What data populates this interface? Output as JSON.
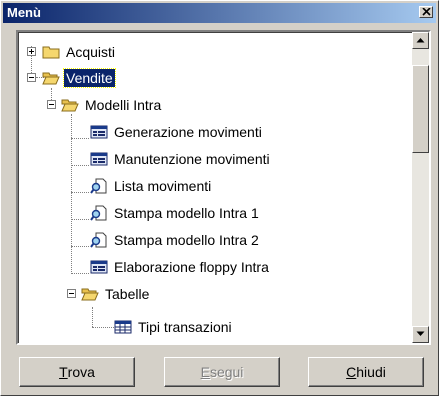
{
  "window": {
    "title": "Menù"
  },
  "tree": {
    "items": [
      {
        "label": "Acquisti",
        "icon": "folder-closed-icon",
        "expander": "plus"
      },
      {
        "label": "Vendite",
        "icon": "folder-open-icon",
        "expander": "minus",
        "selected": true
      },
      {
        "label": "Modelli Intra",
        "icon": "folder-open-icon",
        "expander": "minus"
      },
      {
        "label": "Generazione movimenti",
        "icon": "form-icon"
      },
      {
        "label": "Manutenzione movimenti",
        "icon": "form-icon"
      },
      {
        "label": "Lista movimenti",
        "icon": "report-icon"
      },
      {
        "label": "Stampa modello Intra 1",
        "icon": "report-icon"
      },
      {
        "label": "Stampa modello Intra 2",
        "icon": "report-icon"
      },
      {
        "label": "Elaborazione floppy Intra",
        "icon": "form-icon"
      },
      {
        "label": "Tabelle",
        "icon": "folder-open-icon",
        "expander": "minus"
      },
      {
        "label": "Tipi transazioni",
        "icon": "table-icon"
      }
    ]
  },
  "buttons": {
    "find": {
      "accel": "T",
      "rest": "rova"
    },
    "run": {
      "accel": "E",
      "rest": "segui"
    },
    "close": {
      "accel": "C",
      "rest": "hiudi"
    }
  },
  "colors": {
    "selection": "#0a246a",
    "titlebar": "#0a246a",
    "folder": "#f5d76e"
  }
}
